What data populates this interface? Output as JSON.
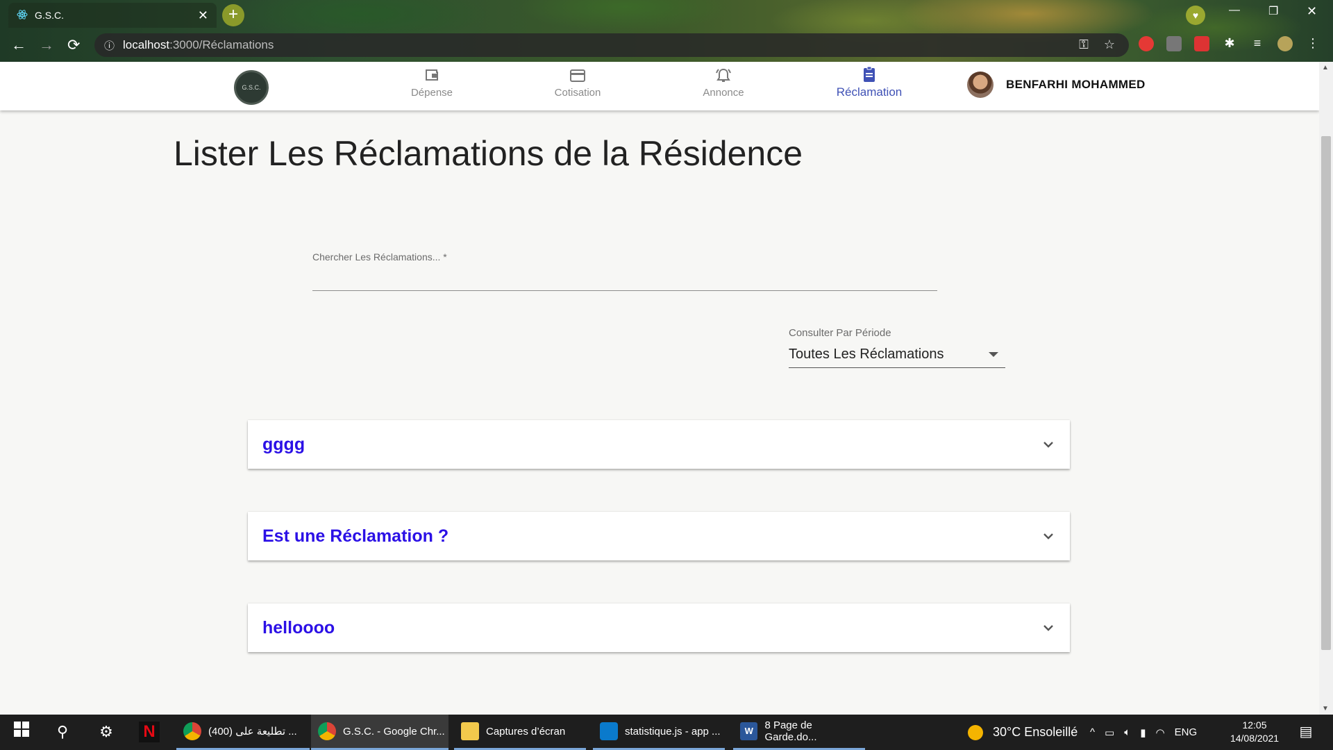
{
  "browser": {
    "tab_title": "G.S.C.",
    "tab_close": "✕",
    "new_tab": "+",
    "url_host": "localhost",
    "url_path": ":3000/Réclamations"
  },
  "header": {
    "logo_text": "G.S.C.",
    "nav": [
      {
        "label": "Dépense",
        "icon": "wallet-icon"
      },
      {
        "label": "Cotisation",
        "icon": "credit-card-icon"
      },
      {
        "label": "Annonce",
        "icon": "bell-icon"
      },
      {
        "label": "Réclamation",
        "icon": "clipboard-icon",
        "active": true
      }
    ],
    "user_name": "BENFARHI MOHAMMED"
  },
  "main": {
    "title": "Lister Les Réclamations de la Résidence",
    "search": {
      "label": "Chercher Les Réclamations... *",
      "value": ""
    },
    "period": {
      "label": "Consulter Par Période",
      "value": "Toutes Les Réclamations"
    },
    "reclamations": [
      {
        "title": "gggg"
      },
      {
        "title": "Est une Réclamation ?"
      },
      {
        "title": "helloooo"
      }
    ]
  },
  "taskbar": {
    "apps": [
      {
        "label": "(400) تطليعة على ..."
      },
      {
        "label": "G.S.C. - Google Chr..."
      },
      {
        "label": "Captures d’écran"
      },
      {
        "label": "statistique.js - app ..."
      },
      {
        "label": "8 Page de Garde.do..."
      }
    ],
    "weather": "30°C  Ensoleillé",
    "language": "ENG",
    "time": "12:05",
    "date": "14/08/2021"
  },
  "colors": {
    "accent": "#3f51b5",
    "reclamation_title": "#2b10e6"
  }
}
